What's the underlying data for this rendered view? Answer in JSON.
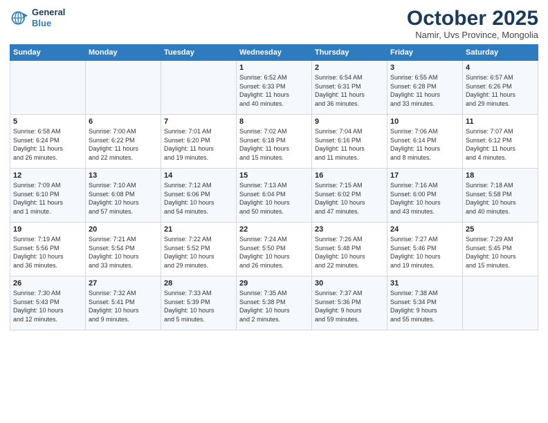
{
  "header": {
    "logo_line1": "General",
    "logo_line2": "Blue",
    "month": "October 2025",
    "location": "Namir, Uvs Province, Mongolia"
  },
  "days_of_week": [
    "Sunday",
    "Monday",
    "Tuesday",
    "Wednesday",
    "Thursday",
    "Friday",
    "Saturday"
  ],
  "weeks": [
    [
      {
        "day": "",
        "info": ""
      },
      {
        "day": "",
        "info": ""
      },
      {
        "day": "",
        "info": ""
      },
      {
        "day": "1",
        "info": "Sunrise: 6:52 AM\nSunset: 6:33 PM\nDaylight: 11 hours\nand 40 minutes."
      },
      {
        "day": "2",
        "info": "Sunrise: 6:54 AM\nSunset: 6:31 PM\nDaylight: 11 hours\nand 36 minutes."
      },
      {
        "day": "3",
        "info": "Sunrise: 6:55 AM\nSunset: 6:28 PM\nDaylight: 11 hours\nand 33 minutes."
      },
      {
        "day": "4",
        "info": "Sunrise: 6:57 AM\nSunset: 6:26 PM\nDaylight: 11 hours\nand 29 minutes."
      }
    ],
    [
      {
        "day": "5",
        "info": "Sunrise: 6:58 AM\nSunset: 6:24 PM\nDaylight: 11 hours\nand 26 minutes."
      },
      {
        "day": "6",
        "info": "Sunrise: 7:00 AM\nSunset: 6:22 PM\nDaylight: 11 hours\nand 22 minutes."
      },
      {
        "day": "7",
        "info": "Sunrise: 7:01 AM\nSunset: 6:20 PM\nDaylight: 11 hours\nand 19 minutes."
      },
      {
        "day": "8",
        "info": "Sunrise: 7:02 AM\nSunset: 6:18 PM\nDaylight: 11 hours\nand 15 minutes."
      },
      {
        "day": "9",
        "info": "Sunrise: 7:04 AM\nSunset: 6:16 PM\nDaylight: 11 hours\nand 11 minutes."
      },
      {
        "day": "10",
        "info": "Sunrise: 7:06 AM\nSunset: 6:14 PM\nDaylight: 11 hours\nand 8 minutes."
      },
      {
        "day": "11",
        "info": "Sunrise: 7:07 AM\nSunset: 6:12 PM\nDaylight: 11 hours\nand 4 minutes."
      }
    ],
    [
      {
        "day": "12",
        "info": "Sunrise: 7:09 AM\nSunset: 6:10 PM\nDaylight: 11 hours\nand 1 minute."
      },
      {
        "day": "13",
        "info": "Sunrise: 7:10 AM\nSunset: 6:08 PM\nDaylight: 10 hours\nand 57 minutes."
      },
      {
        "day": "14",
        "info": "Sunrise: 7:12 AM\nSunset: 6:06 PM\nDaylight: 10 hours\nand 54 minutes."
      },
      {
        "day": "15",
        "info": "Sunrise: 7:13 AM\nSunset: 6:04 PM\nDaylight: 10 hours\nand 50 minutes."
      },
      {
        "day": "16",
        "info": "Sunrise: 7:15 AM\nSunset: 6:02 PM\nDaylight: 10 hours\nand 47 minutes."
      },
      {
        "day": "17",
        "info": "Sunrise: 7:16 AM\nSunset: 6:00 PM\nDaylight: 10 hours\nand 43 minutes."
      },
      {
        "day": "18",
        "info": "Sunrise: 7:18 AM\nSunset: 5:58 PM\nDaylight: 10 hours\nand 40 minutes."
      }
    ],
    [
      {
        "day": "19",
        "info": "Sunrise: 7:19 AM\nSunset: 5:56 PM\nDaylight: 10 hours\nand 36 minutes."
      },
      {
        "day": "20",
        "info": "Sunrise: 7:21 AM\nSunset: 5:54 PM\nDaylight: 10 hours\nand 33 minutes."
      },
      {
        "day": "21",
        "info": "Sunrise: 7:22 AM\nSunset: 5:52 PM\nDaylight: 10 hours\nand 29 minutes."
      },
      {
        "day": "22",
        "info": "Sunrise: 7:24 AM\nSunset: 5:50 PM\nDaylight: 10 hours\nand 26 minutes."
      },
      {
        "day": "23",
        "info": "Sunrise: 7:26 AM\nSunset: 5:48 PM\nDaylight: 10 hours\nand 22 minutes."
      },
      {
        "day": "24",
        "info": "Sunrise: 7:27 AM\nSunset: 5:46 PM\nDaylight: 10 hours\nand 19 minutes."
      },
      {
        "day": "25",
        "info": "Sunrise: 7:29 AM\nSunset: 5:45 PM\nDaylight: 10 hours\nand 15 minutes."
      }
    ],
    [
      {
        "day": "26",
        "info": "Sunrise: 7:30 AM\nSunset: 5:43 PM\nDaylight: 10 hours\nand 12 minutes."
      },
      {
        "day": "27",
        "info": "Sunrise: 7:32 AM\nSunset: 5:41 PM\nDaylight: 10 hours\nand 9 minutes."
      },
      {
        "day": "28",
        "info": "Sunrise: 7:33 AM\nSunset: 5:39 PM\nDaylight: 10 hours\nand 5 minutes."
      },
      {
        "day": "29",
        "info": "Sunrise: 7:35 AM\nSunset: 5:38 PM\nDaylight: 10 hours\nand 2 minutes."
      },
      {
        "day": "30",
        "info": "Sunrise: 7:37 AM\nSunset: 5:36 PM\nDaylight: 9 hours\nand 59 minutes."
      },
      {
        "day": "31",
        "info": "Sunrise: 7:38 AM\nSunset: 5:34 PM\nDaylight: 9 hours\nand 55 minutes."
      },
      {
        "day": "",
        "info": ""
      }
    ]
  ]
}
